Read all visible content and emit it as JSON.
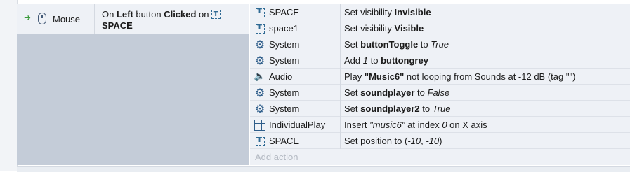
{
  "event": {
    "object_name": "Mouse",
    "condition": {
      "prefix": "On ",
      "button": "Left",
      "mid1": " button ",
      "state": "Clicked",
      "mid2": " on",
      "target": "SPACE"
    }
  },
  "actions": [
    {
      "icon": "text-object-icon",
      "object": "SPACE",
      "text": [
        {
          "t": "Set visibility "
        },
        {
          "t": "Invisible",
          "b": true
        }
      ]
    },
    {
      "icon": "text-object-icon",
      "object": "space1",
      "text": [
        {
          "t": "Set visibility "
        },
        {
          "t": "Visible",
          "b": true
        }
      ]
    },
    {
      "icon": "gear-icon",
      "object": "System",
      "text": [
        {
          "t": "Set "
        },
        {
          "t": "buttonToggle",
          "b": true
        },
        {
          "t": " to "
        },
        {
          "t": "True",
          "i": true
        }
      ]
    },
    {
      "icon": "gear-icon",
      "object": "System",
      "text": [
        {
          "t": "Add "
        },
        {
          "t": "1",
          "i": true
        },
        {
          "t": " to "
        },
        {
          "t": "buttongrey",
          "b": true
        }
      ]
    },
    {
      "icon": "speaker-icon",
      "object": "Audio",
      "text": [
        {
          "t": "Play "
        },
        {
          "t": "\"Music6\"",
          "b": true
        },
        {
          "t": " not looping from Sounds at -12 dB (tag \"\")"
        }
      ]
    },
    {
      "icon": "gear-icon",
      "object": "System",
      "text": [
        {
          "t": "Set "
        },
        {
          "t": "soundplayer",
          "b": true
        },
        {
          "t": " to "
        },
        {
          "t": "False",
          "i": true
        }
      ]
    },
    {
      "icon": "gear-icon",
      "object": "System",
      "text": [
        {
          "t": "Set "
        },
        {
          "t": "soundplayer2",
          "b": true
        },
        {
          "t": " to "
        },
        {
          "t": "True",
          "i": true
        }
      ]
    },
    {
      "icon": "grid-icon",
      "object": "IndividualPlay",
      "text": [
        {
          "t": "Insert "
        },
        {
          "t": "\"music6\"",
          "i": true
        },
        {
          "t": " at index "
        },
        {
          "t": "0",
          "i": true
        },
        {
          "t": " on X axis"
        }
      ]
    },
    {
      "icon": "text-object-icon",
      "object": "SPACE",
      "text": [
        {
          "t": "Set position to ("
        },
        {
          "t": "-10",
          "i": true
        },
        {
          "t": ", "
        },
        {
          "t": "-10",
          "i": true
        },
        {
          "t": ")"
        }
      ]
    }
  ],
  "add_action_label": "Add action"
}
